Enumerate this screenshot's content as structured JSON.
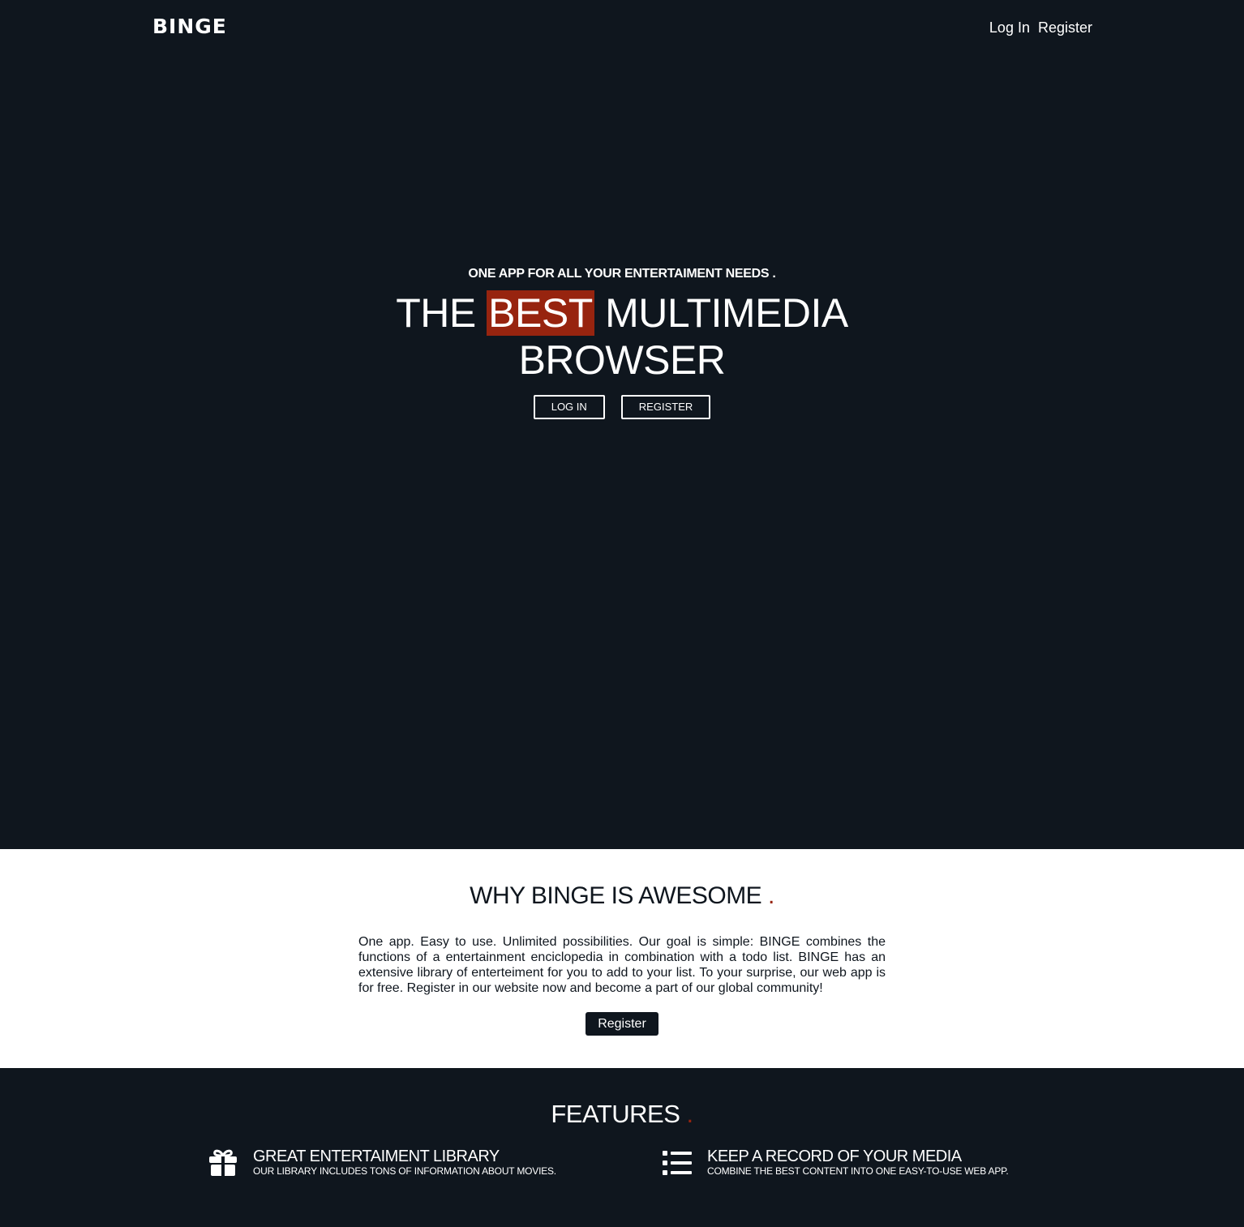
{
  "nav": {
    "logo": "BINGE",
    "login_label": "Log In",
    "register_label": "Register"
  },
  "hero": {
    "tagline": "ONE APP FOR ALL YOUR ENTERTAIMENT NEEDS .",
    "title_pre": "THE ",
    "title_highlight": "BEST",
    "title_post": " MULTIMEDIA BROWSER",
    "login_button": "LOG IN",
    "register_button": "REGISTER"
  },
  "why": {
    "title": "WHY BINGE IS AWESOME ",
    "title_dot": ".",
    "text": "One app. Easy to use. Unlimited possibilities. Our goal is simple: BINGE combines the functions of a entertainment enciclopedia in combination with a todo list. BINGE has an extensive library of enterteiment for you to add to your list. To your surprise, our web app is for free. Register in our website now and become a part of our global community!",
    "register_button": "Register"
  },
  "features": {
    "title": "FEATURES ",
    "title_dot": ".",
    "items": [
      {
        "icon": "gift-icon",
        "title": "GREAT ENTERTAIMENT LIBRARY",
        "desc": "OUR LIBRARY INCLUDES TONS OF INFORMATION ABOUT MOVIES."
      },
      {
        "icon": "list-icon",
        "title": "KEEP A RECORD OF YOUR MEDIA",
        "desc": "COMBINE THE BEST CONTENT INTO ONE EASY-TO-USE WEB APP."
      }
    ]
  },
  "colors": {
    "dark_bg": "#0f161e",
    "accent": "#97240f",
    "light_bg": "#ffffff"
  }
}
